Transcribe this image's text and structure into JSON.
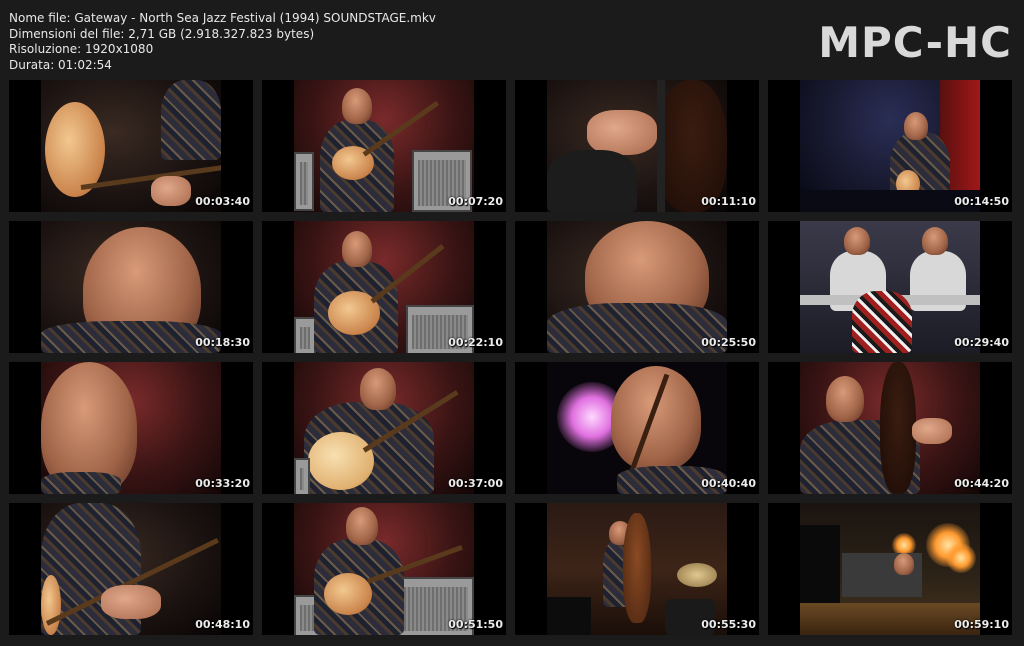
{
  "file_info": {
    "name_line": "Nome file: Gateway - North Sea Jazz Festival (1994) SOUNDSTAGE.mkv",
    "size_line": "Dimensioni del file: 2,71 GB (2.918.327.823 bytes)",
    "resolution_line": "Risoluzione: 1920x1080",
    "duration_line": "Durata: 01:02:54"
  },
  "logo": "MPC-HC",
  "thumbnails": [
    {
      "timestamp": "00:03:40",
      "scene": "guitar closeup"
    },
    {
      "timestamp": "00:07:20",
      "scene": "guitarist with amps"
    },
    {
      "timestamp": "00:11:10",
      "scene": "bass hand closeup"
    },
    {
      "timestamp": "00:14:50",
      "scene": "guitarist blue stage"
    },
    {
      "timestamp": "00:18:30",
      "scene": "face closeup"
    },
    {
      "timestamp": "00:22:10",
      "scene": "guitarist with amps"
    },
    {
      "timestamp": "00:25:50",
      "scene": "bassist face closeup"
    },
    {
      "timestamp": "00:29:40",
      "scene": "drummer at kit"
    },
    {
      "timestamp": "00:33:20",
      "scene": "face closeup"
    },
    {
      "timestamp": "00:37:00",
      "scene": "acoustic guitarist"
    },
    {
      "timestamp": "00:40:40",
      "scene": "bassist with light"
    },
    {
      "timestamp": "00:44:20",
      "scene": "upright bassist"
    },
    {
      "timestamp": "00:48:10",
      "scene": "guitar neck closeup"
    },
    {
      "timestamp": "00:51:50",
      "scene": "guitarist with amps"
    },
    {
      "timestamp": "00:55:30",
      "scene": "bassist and drums wide"
    },
    {
      "timestamp": "00:59:10",
      "scene": "stage wide shot"
    }
  ]
}
